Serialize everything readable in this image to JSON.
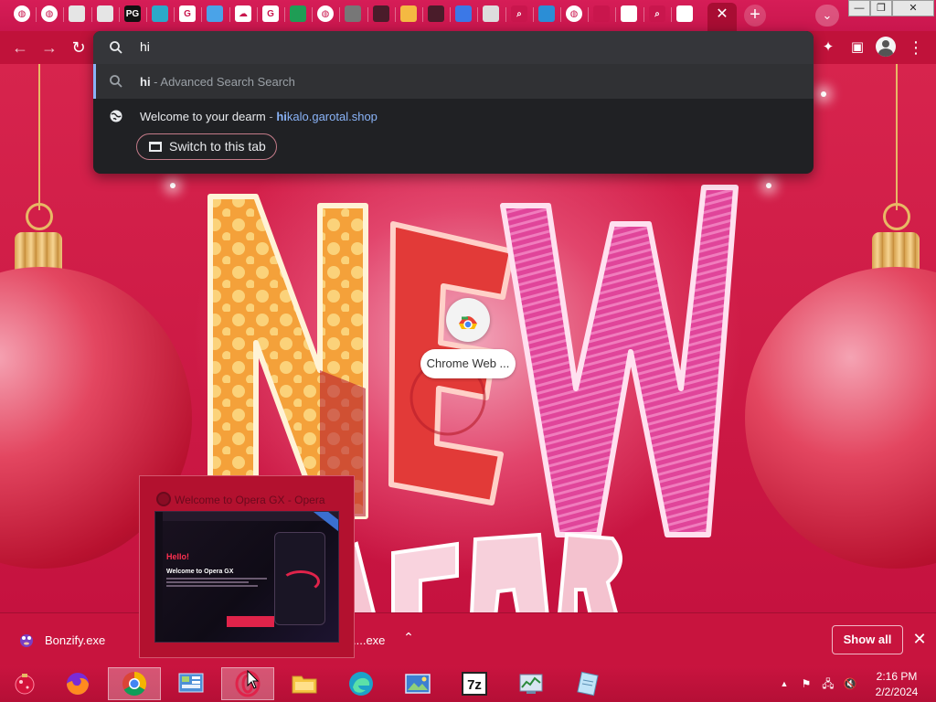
{
  "browser": {
    "tab_close_glyph": "✕",
    "new_tab_glyph": "+",
    "tab_search_glyph": "⌄",
    "tab_icons": [
      {
        "name": "globe-icon",
        "color": "#ffffff",
        "glyph": "◍"
      },
      {
        "name": "globe-icon",
        "color": "#ffffff",
        "glyph": "◍"
      },
      {
        "name": "page-icon",
        "color": "#e5e5e5",
        "glyph": ""
      },
      {
        "name": "page-icon",
        "color": "#e5e5e5",
        "glyph": ""
      },
      {
        "name": "pg-icon",
        "color": "#111111",
        "glyph": "PG"
      },
      {
        "name": "edge-icon",
        "color": "#2ba9c9",
        "glyph": ""
      },
      {
        "name": "google-icon",
        "color": "#ffffff",
        "glyph": "G"
      },
      {
        "name": "pokemon-icon",
        "color": "#4aa3e8",
        "glyph": ""
      },
      {
        "name": "cloud-icon",
        "color": "#ffffff",
        "glyph": "☁"
      },
      {
        "name": "google-icon",
        "color": "#ffffff",
        "glyph": "G"
      },
      {
        "name": "earth-icon",
        "color": "#1f9d55",
        "glyph": ""
      },
      {
        "name": "globe-icon",
        "color": "#ffffff",
        "glyph": "◍"
      },
      {
        "name": "photo-icon",
        "color": "#777777",
        "glyph": ""
      },
      {
        "name": "monster-icon",
        "color": "#4a1c2a",
        "glyph": ""
      },
      {
        "name": "palette-icon",
        "color": "#f4b942",
        "glyph": ""
      },
      {
        "name": "monster-icon",
        "color": "#4a1c2a",
        "glyph": ""
      },
      {
        "name": "chrome-store-icon",
        "color": "#3b78e7",
        "glyph": ""
      },
      {
        "name": "grid-icon",
        "color": "#dddddd",
        "glyph": ""
      },
      {
        "name": "search-icon",
        "color": "#c9164d",
        "glyph": "⌕"
      },
      {
        "name": "puzzle-icon",
        "color": "#2b8ed6",
        "glyph": ""
      },
      {
        "name": "globe-icon",
        "color": "#ffffff",
        "glyph": "◍"
      },
      {
        "name": "star-icon",
        "color": "#c9164d",
        "glyph": ""
      },
      {
        "name": "museum-icon",
        "color": "#ffffff",
        "glyph": ""
      },
      {
        "name": "search-icon",
        "color": "#c9164d",
        "glyph": "⌕"
      },
      {
        "name": "github-icon",
        "color": "#ffffff",
        "glyph": ""
      }
    ],
    "window_controls": {
      "minimize": "—",
      "maximize": "❐",
      "close": "✕"
    },
    "toolbar": {
      "back": "←",
      "forward": "→",
      "reload": "↻",
      "extensions": "✦",
      "sidepanel": "▣",
      "menu": "⋮"
    }
  },
  "omnibox": {
    "input_value": "hi",
    "suggestions": [
      {
        "match": "hi",
        "separator": " - ",
        "description": "Advanced Search Search",
        "icon": "search-icon"
      },
      {
        "title": "Welcome to your dearm",
        "separator": " - ",
        "url_match": "hi",
        "url_rest": "kalo.garotal.shop",
        "icon": "globe-icon"
      }
    ],
    "switch_tab_label": "Switch to this tab"
  },
  "page": {
    "shortcut_label": "Chrome Web ...",
    "shortcut_icon": "chrome-web-store-icon",
    "headline": "NEW",
    "subline": "YEAR"
  },
  "downloads": {
    "item1": "Bonzify.exe",
    "item2": "....exe",
    "show_all": "Show all",
    "close_glyph": "✕",
    "caret_glyph": "⌃"
  },
  "thumbnail": {
    "title": "Welcome to Opera GX - Opera",
    "hello": "Hello!",
    "welcome": "Welcome to Opera GX"
  },
  "taskbar": {
    "apps": [
      "christmas-ornament-icon",
      "firefox-icon",
      "chrome-icon",
      "control-panel-icon",
      "opera-gx-icon",
      "file-explorer-icon",
      "edge-icon",
      "photos-icon",
      "7zip-icon",
      "task-manager-icon",
      "notepad-icon"
    ],
    "time": "2:16 PM",
    "date": "2/2/2024"
  }
}
